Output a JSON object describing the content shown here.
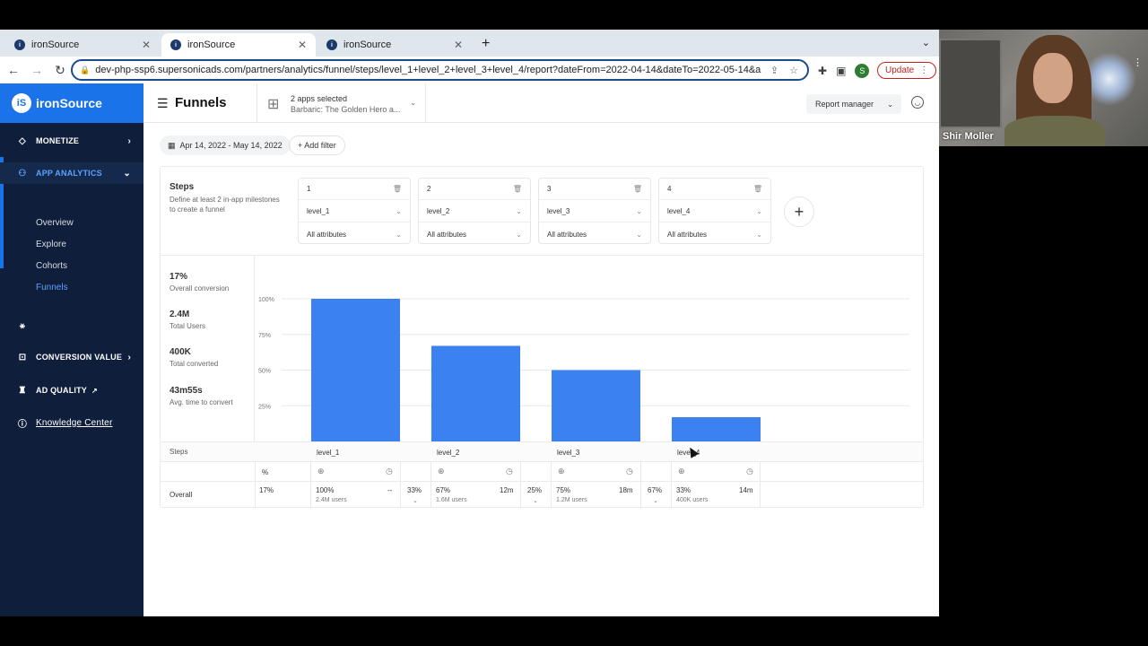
{
  "browser": {
    "tabs": [
      {
        "title": "ironSource"
      },
      {
        "title": "ironSource"
      },
      {
        "title": "ironSource"
      }
    ],
    "url": "dev-php-ssp6.supersonicads.com/partners/analytics/funnel/steps/level_1+level_2+level_3+level_4/report?dateFrom=2022-04-14&dateTo=2022-05-14&a...",
    "profile_letter": "S",
    "update_label": "Update"
  },
  "sidebar": {
    "logo_text": "ironSource",
    "logo_mark": "iS",
    "monetize": "MONETIZE",
    "app_analytics": "APP ANALYTICS",
    "sub_items": [
      "Overview",
      "Explore",
      "Cohorts",
      "Funnels"
    ],
    "conversion_value": "CONVERSION VALUE",
    "ad_quality": "AD QUALITY",
    "knowledge_center": "Knowledge Center"
  },
  "header": {
    "title": "Funnels",
    "apps_selected": "2 apps selected",
    "app_name": "Barbaric: The Golden Hero a...",
    "report_manager": "Report manager"
  },
  "filters": {
    "date_range": "Apr 14, 2022 - May 14, 2022",
    "add_filter": "+ Add filter"
  },
  "steps_panel": {
    "title": "Steps",
    "description": "Define at least 2 in-app milestones to create a funnel",
    "steps": [
      {
        "number": "1",
        "event": "level_1",
        "attributes": "All attributes"
      },
      {
        "number": "2",
        "event": "level_2",
        "attributes": "All attributes"
      },
      {
        "number": "3",
        "event": "level_3",
        "attributes": "All attributes"
      },
      {
        "number": "4",
        "event": "level_4",
        "attributes": "All attributes"
      }
    ]
  },
  "metrics": [
    {
      "value": "17%",
      "label": "Overall conversion"
    },
    {
      "value": "2.4M",
      "label": "Total Users"
    },
    {
      "value": "400K",
      "label": "Total converted"
    },
    {
      "value": "43m55s",
      "label": "Avg. time to convert"
    }
  ],
  "chart_data": {
    "type": "bar",
    "categories": [
      "level_1",
      "level_2",
      "level_3",
      "level_4"
    ],
    "values": [
      100,
      67,
      50,
      17
    ],
    "yticks": [
      "100%",
      "75%",
      "50%",
      "25%"
    ],
    "ylim": [
      0,
      100
    ],
    "bar_color": "#3b82f0",
    "grid": true
  },
  "table": {
    "steps_label": "Steps",
    "overall_label": "Overall",
    "pct_symbol": "%",
    "overall_pct": "17%",
    "cells": [
      {
        "pct": "100%",
        "users": "2.4M users",
        "time": "--",
        "drop": "33%"
      },
      {
        "pct": "67%",
        "users": "1.6M users",
        "time": "12m",
        "drop": "25%"
      },
      {
        "pct": "75%",
        "users": "1.2M users",
        "time": "18m",
        "drop": "67%"
      },
      {
        "pct": "33%",
        "users": "400K users",
        "time": "14m",
        "drop": ""
      }
    ]
  },
  "webcam": {
    "name": "Shir Moller"
  }
}
